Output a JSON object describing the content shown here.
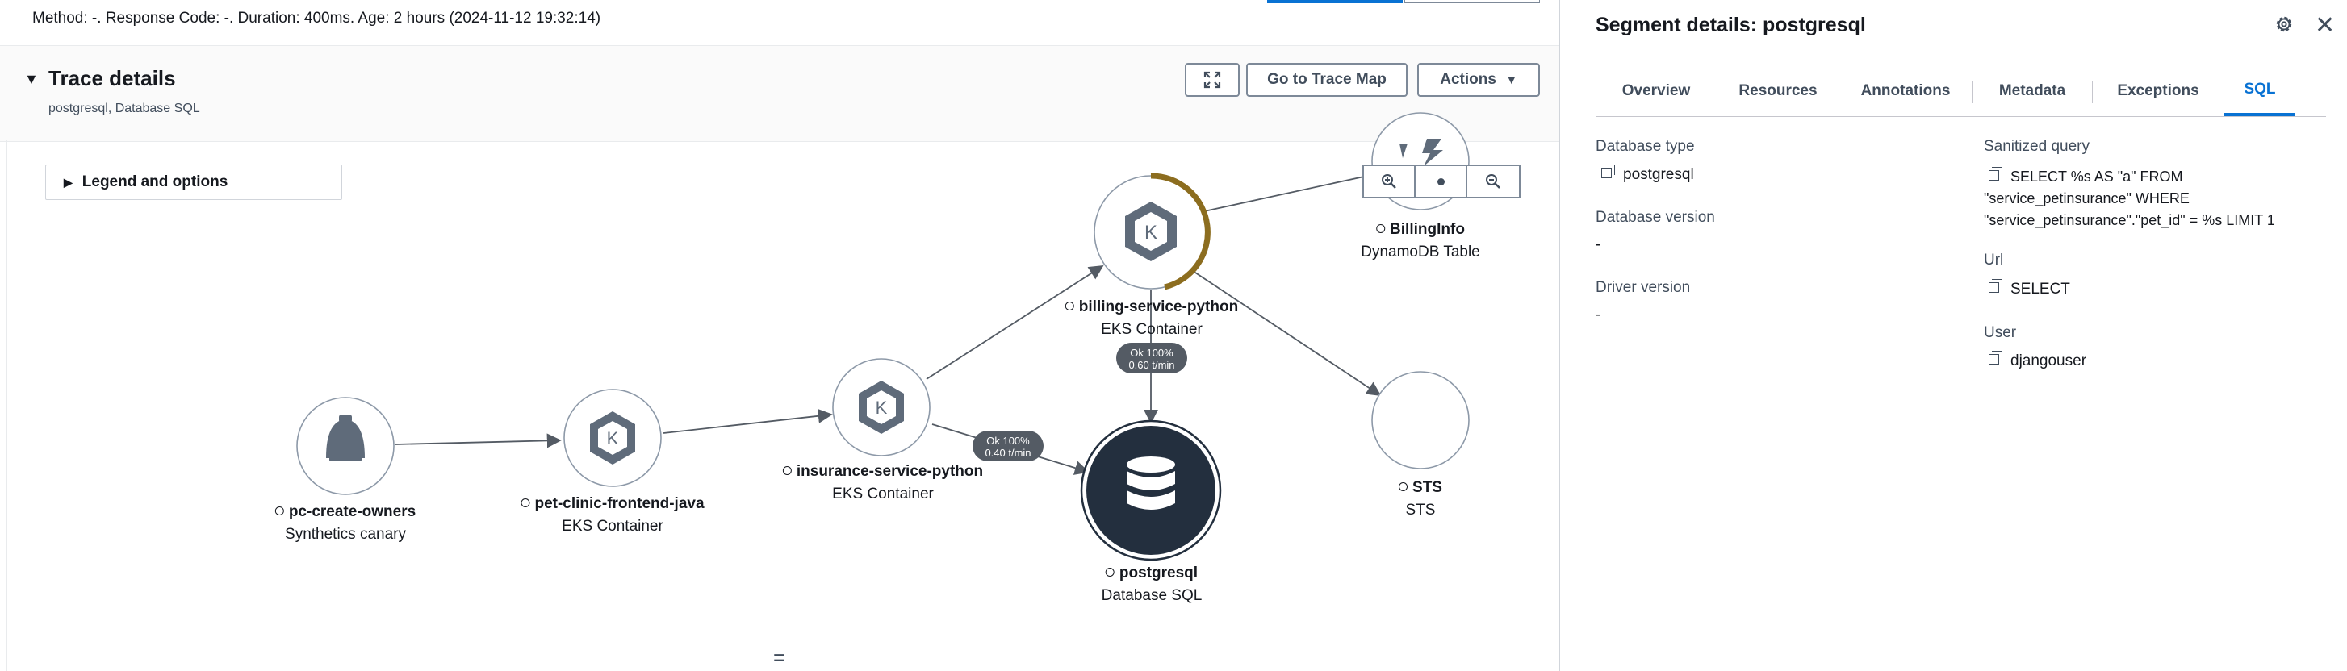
{
  "summary": {
    "meta_line": "Method: -. Response Code: -. Duration: 400ms. Age: 2 hours (2024-11-12 19:32:14)"
  },
  "trace": {
    "title": "Trace details",
    "subtitle": "postgresql, Database SQL",
    "go_to_trace_map": "Go to Trace Map",
    "actions": "Actions",
    "legend": "Legend and options"
  },
  "graph": {
    "nodes": [
      {
        "name": "pc-create-owners",
        "type": "Synthetics canary",
        "icon": "canary-icon"
      },
      {
        "name": "pet-clinic-frontend-java",
        "type": "EKS Container",
        "icon": "kubernetes-icon"
      },
      {
        "name": "insurance-service-python",
        "type": "EKS Container",
        "icon": "kubernetes-icon"
      },
      {
        "name": "billing-service-python",
        "type": "EKS Container",
        "icon": "kubernetes-icon"
      },
      {
        "name": "BillingInfo",
        "type": "DynamoDB Table",
        "icon": "dynamodb-icon"
      },
      {
        "name": "postgresql",
        "type": "Database SQL",
        "icon": "database-icon"
      },
      {
        "name": "STS",
        "type": "STS",
        "icon": "none"
      }
    ],
    "edge_labels": [
      {
        "line1": "Ok 100%",
        "line2": "0.60 t/min"
      },
      {
        "line1": "Ok 100%",
        "line2": "0.40 t/min"
      }
    ],
    "zoom_controls": [
      "zoom-in-icon",
      "center-icon",
      "zoom-out-icon"
    ]
  },
  "segment": {
    "title": "Segment details: postgresql",
    "tabs": [
      "Overview",
      "Resources",
      "Annotations",
      "Metadata",
      "Exceptions",
      "SQL"
    ],
    "active_tab": "SQL",
    "fields": {
      "db_type_label": "Database type",
      "db_type_value": "postgresql",
      "db_version_label": "Database version",
      "db_version_value": "-",
      "driver_version_label": "Driver version",
      "driver_version_value": "-",
      "sanitized_query_label": "Sanitized query",
      "sanitized_query_value": "SELECT %s AS \"a\" FROM \"service_petinsurance\" WHERE \"service_petinsurance\".\"pet_id\" = %s LIMIT 1",
      "url_label": "Url",
      "url_value": "SELECT",
      "user_label": "User",
      "user_value": "djangouser"
    }
  },
  "colors": {
    "accent": "#0972d3",
    "node_ring_highlight": "#8c6d1f",
    "database_fill": "#232f3e"
  }
}
